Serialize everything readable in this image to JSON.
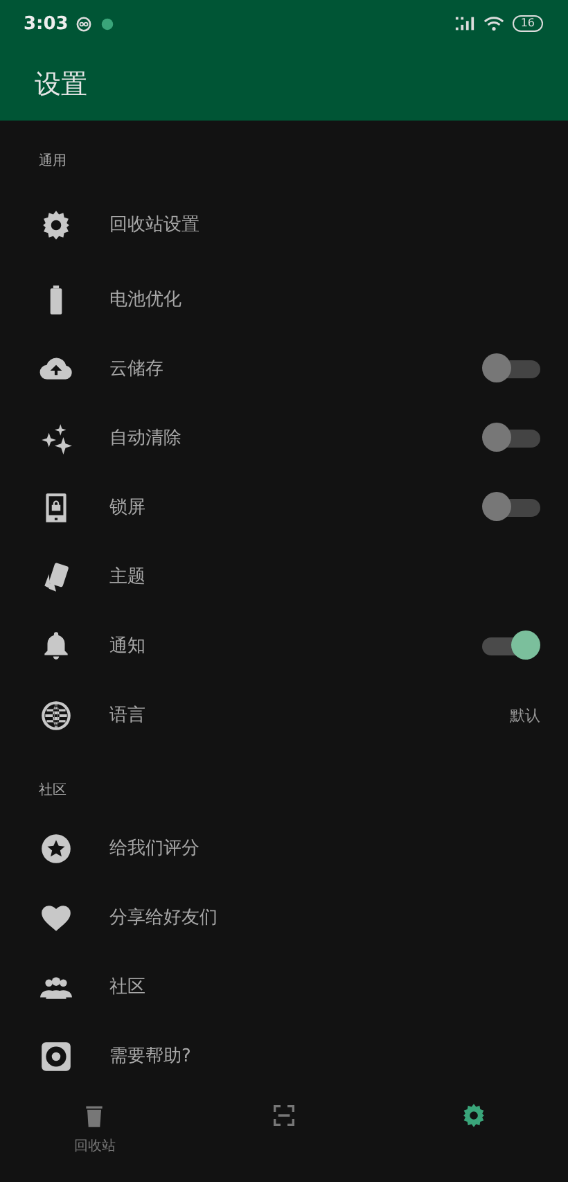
{
  "status_bar": {
    "time": "3:03",
    "battery": "16"
  },
  "app_bar": {
    "title": "设置"
  },
  "sections": [
    {
      "title": "通用",
      "items": [
        {
          "label": "回收站设置",
          "kind": "plain"
        },
        {
          "label": "电池优化",
          "kind": "plain"
        },
        {
          "label": "云储存",
          "kind": "toggle",
          "on": false
        },
        {
          "label": "自动清除",
          "kind": "toggle",
          "on": false
        },
        {
          "label": "锁屏",
          "kind": "toggle",
          "on": false
        },
        {
          "label": "主题",
          "kind": "plain"
        },
        {
          "label": "通知",
          "kind": "toggle",
          "on": true
        },
        {
          "label": "语言",
          "kind": "value",
          "value": "默认"
        }
      ]
    },
    {
      "title": "社区",
      "items": [
        {
          "label": "给我们评分",
          "kind": "plain"
        },
        {
          "label": "分享给好友们",
          "kind": "plain"
        },
        {
          "label": "社区",
          "kind": "plain"
        },
        {
          "label": "需要帮助?",
          "kind": "plain"
        }
      ]
    }
  ],
  "bottom_nav": [
    {
      "label": "回收站",
      "selected": false
    },
    {
      "selected": false
    },
    {
      "selected": true
    }
  ]
}
